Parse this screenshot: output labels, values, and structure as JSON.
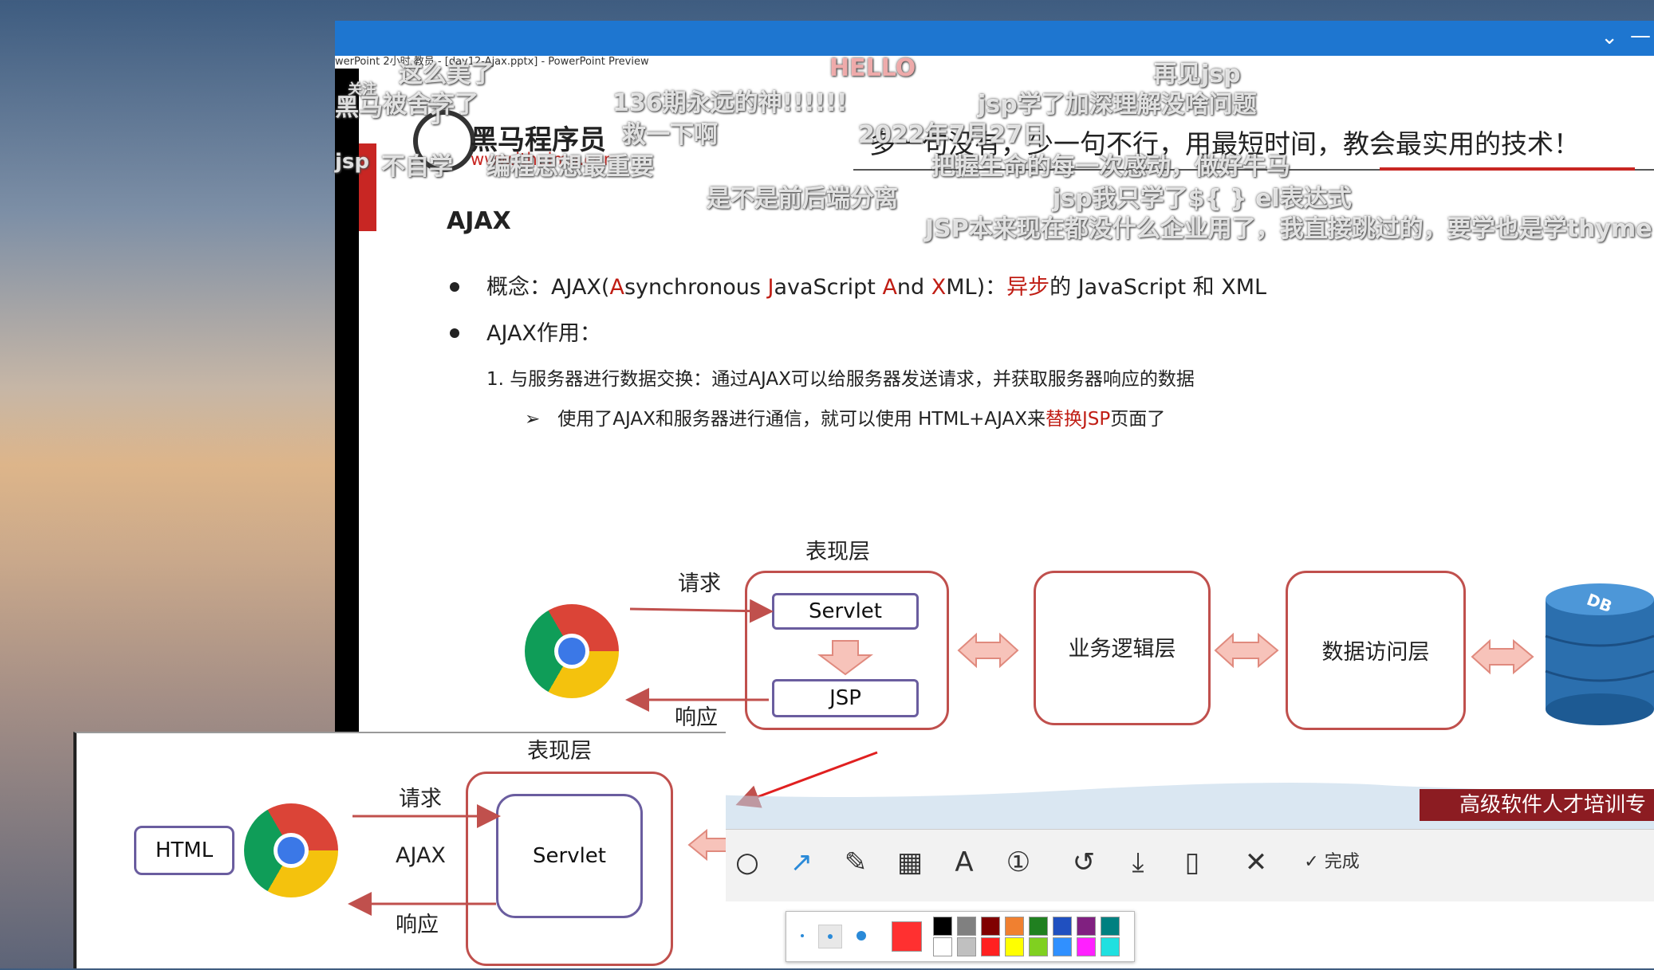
{
  "window": {
    "title": "werPoint 2小时 教员 - [day12-Ajax.pptx] - PowerPoint Preview"
  },
  "logo": {
    "name": "黑马程序员",
    "url": "www.itheima.com"
  },
  "slide": {
    "slogan": "多一句没有，少一句不行，用最短时间，教会最实用的技术！",
    "heading": "AJAX",
    "bullet1": {
      "prefix": "概念：AJAX(",
      "a": "A",
      "t1": "synchronous ",
      "j": "J",
      "t2": "avaScript ",
      "and": "A",
      "t3": "nd ",
      "x": "X",
      "t4": "ML)：",
      "async": "异步",
      "suffix": "的 JavaScript 和 XML"
    },
    "bullet2": "AJAX作用：",
    "item1": "1.    与服务器进行数据交换：通过AJAX可以给服务器发送请求，并获取服务器响应的数据",
    "item1a": {
      "arrow": "➢",
      "prefix": "使用了AJAX和服务器进行通信，就可以使用 HTML+AJAX来",
      "replace": "替换JSP",
      "suffix": "页面了"
    }
  },
  "diagram": {
    "presentation_label": "表现层",
    "request": "请求",
    "response": "响应",
    "servlet": "Servlet",
    "jsp": "JSP",
    "business": "业务逻辑层",
    "data_access": "数据访问层",
    "db": "DB"
  },
  "overlay": {
    "presentation_label": "表现层",
    "html": "HTML",
    "request": "请求",
    "ajax": "AJAX",
    "response": "响应",
    "servlet": "Servlet"
  },
  "danmaku": [
    "关注",
    "136期永远的神!!!!!!",
    "HELLO",
    "再见jsp",
    "jsp学了加深理解没啥问题",
    "2022年7月27日",
    "编程思想最重要",
    "不自学",
    "jsp",
    "是不是前后端分离",
    "把握生命的每一次感动，做好牛马",
    "jsp我只学了${ }  el表达式",
    "JSP本来现在都没什么企业用了，我直接跳过的，要学也是学thyme",
    "这么美了",
    "被舍弃了",
    "黑马",
    "了",
    "救一下啊"
  ],
  "toolbar": {
    "done": "完成"
  },
  "banner": "高级软件人才培训专",
  "palette": {
    "colors": [
      "#000000",
      "#808080",
      "#800000",
      "#f08030",
      "#208020",
      "#2050c0",
      "#802080",
      "#008080",
      "#ffffff",
      "#c0c0c0",
      "#ff2020",
      "#ffff00",
      "#80d020",
      "#3090ff",
      "#ff20ff",
      "#20e0e0"
    ],
    "current": "#ff3030"
  }
}
